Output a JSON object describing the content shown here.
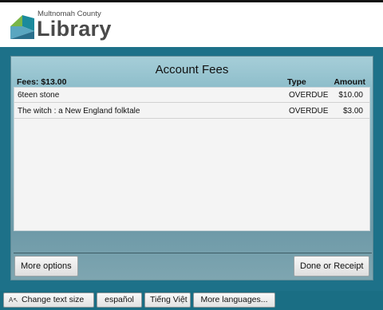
{
  "header": {
    "logo_subtitle": "Multnomah County",
    "logo_title": "Library"
  },
  "panel": {
    "title": "Account Fees",
    "fees_label": "Fees: $13.00",
    "col_type": "Type",
    "col_amount": "Amount",
    "rows": [
      {
        "title": "6teen stone",
        "type": "OVERDUE",
        "amount": "$10.00"
      },
      {
        "title": "The witch : a New England folktale",
        "type": "OVERDUE",
        "amount": "$3.00"
      }
    ]
  },
  "buttons": {
    "more_options": "More options",
    "done_receipt": "Done or Receipt"
  },
  "language_bar": {
    "text_size_icon": "text-size-icon",
    "text_size": "Change text size",
    "spanish": "español",
    "vietnamese": "Tiếng Việt",
    "more_languages": "More languages..."
  },
  "colors": {
    "brand_green": "#7ab648",
    "brand_teal": "#1a6e84",
    "logo_gray": "#4a4a4a"
  }
}
